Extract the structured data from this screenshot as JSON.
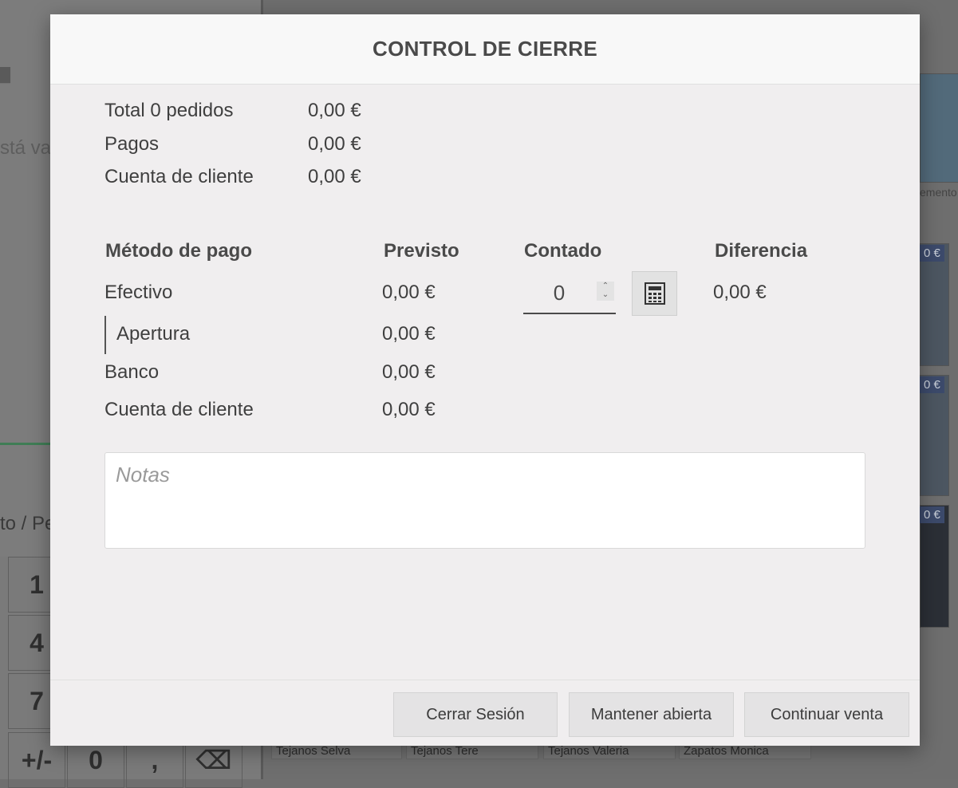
{
  "background": {
    "empty_cart_text": "stá va",
    "mode_text": "to / Pe",
    "supplement_text": "emento",
    "keypad_keys": [
      "1",
      "4",
      "7",
      "+/-",
      "0",
      ","
    ],
    "price_badges": [
      "0 €",
      "0 €",
      "0 €"
    ],
    "products": [
      "Tejanos Selva",
      "Tejanos Tere",
      "Tejanos Valeria",
      "Zapatos Monica"
    ]
  },
  "modal": {
    "title": "CONTROL DE CIERRE",
    "summary": [
      {
        "label": "Total 0 pedidos",
        "value": "0,00 €"
      },
      {
        "label": "Pagos",
        "value": "0,00 €"
      },
      {
        "label": "Cuenta de cliente",
        "value": "0,00 €"
      }
    ],
    "table": {
      "headers": {
        "method": "Método de pago",
        "expected": "Previsto",
        "counted": "Contado",
        "difference": "Diferencia"
      },
      "cash": {
        "label": "Efectivo",
        "expected": "0,00 €",
        "counted": "0",
        "difference": "0,00 €"
      },
      "opening": {
        "label": "Apertura",
        "expected": "0,00 €"
      },
      "bank": {
        "label": "Banco",
        "expected": "0,00 €"
      },
      "customer_account": {
        "label": "Cuenta de cliente",
        "expected": "0,00 €"
      }
    },
    "notes": {
      "placeholder": "Notas"
    },
    "buttons": {
      "close_session": "Cerrar Sesión",
      "keep_open": "Mantener abierta",
      "continue_selling": "Continuar venta"
    }
  },
  "colors": {
    "modal_bg": "#f0eeef",
    "header_bg": "#f8f8f8",
    "button_bg": "#e4e3e4",
    "text": "#3f3f3f"
  }
}
